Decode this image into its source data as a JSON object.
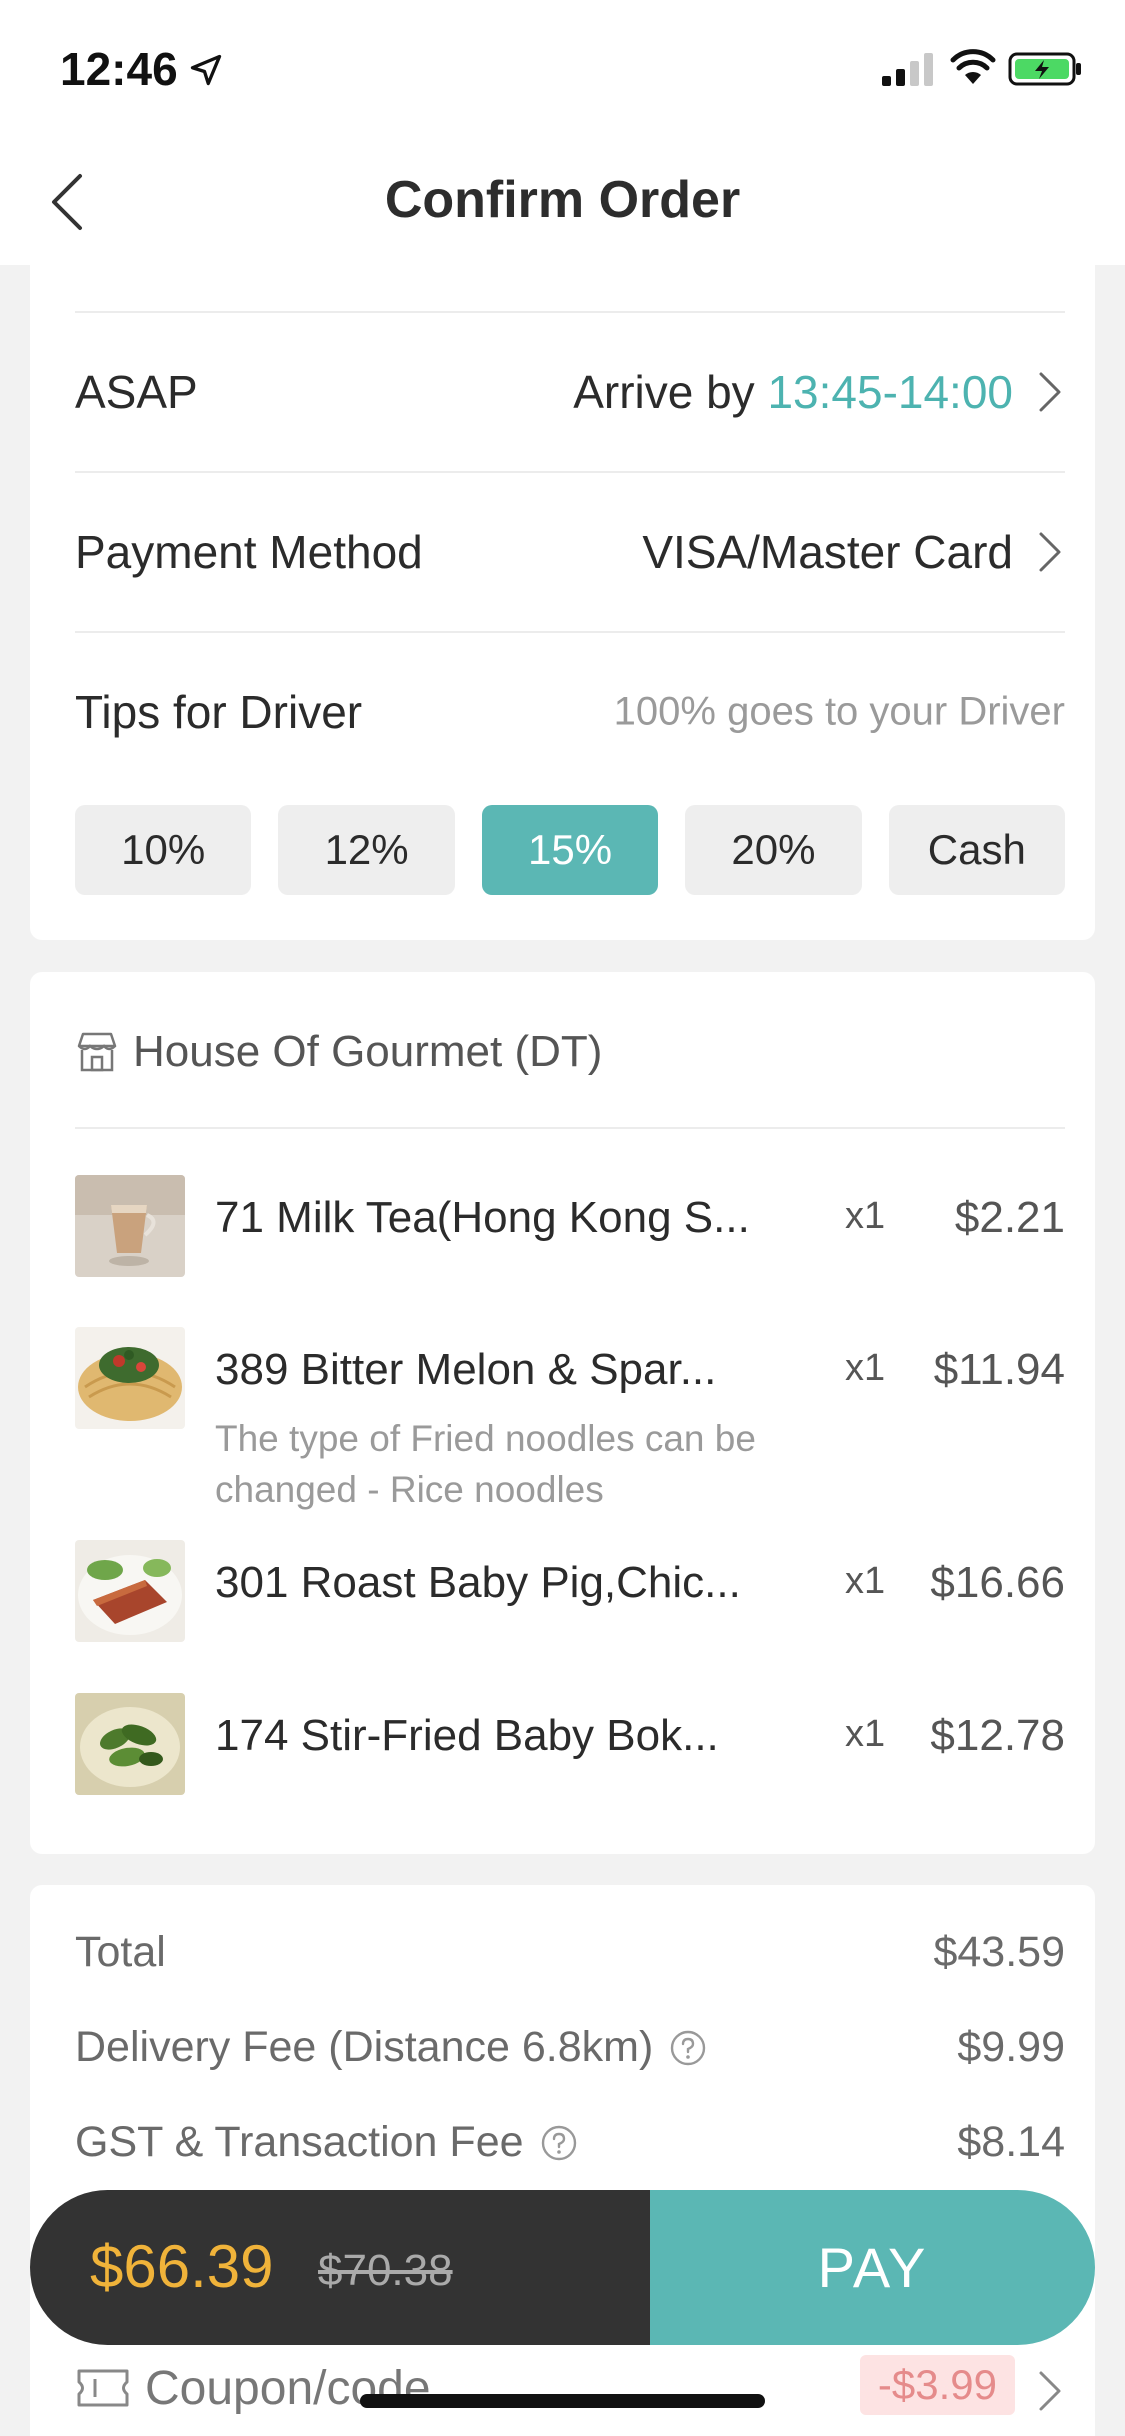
{
  "status_bar": {
    "time": "12:46"
  },
  "nav": {
    "title": "Confirm Order"
  },
  "delivery": {
    "label": "ASAP",
    "value_prefix": "Arrive by ",
    "value_time": "13:45-14:00"
  },
  "payment": {
    "label": "Payment Method",
    "value": "VISA/Master Card"
  },
  "tips": {
    "label": "Tips for Driver",
    "hint": "100% goes to your Driver",
    "options": [
      "10%",
      "12%",
      "15%",
      "20%",
      "Cash"
    ],
    "selected": "15%"
  },
  "restaurant": {
    "name": "House Of Gourmet (DT)"
  },
  "items": [
    {
      "name": "71 Milk Tea(Hong Kong S...",
      "note": "",
      "qty": "x1",
      "price": "$2.21"
    },
    {
      "name": "389 Bitter Melon & Spar...",
      "note": "The type of Fried noodles can be changed -  Rice noodles",
      "qty": "x1",
      "price": "$11.94"
    },
    {
      "name": "301 Roast Baby Pig,Chic...",
      "note": "",
      "qty": "x1",
      "price": "$16.66"
    },
    {
      "name": "174 Stir-Fried Baby Bok...",
      "note": "",
      "qty": "x1",
      "price": "$12.78"
    }
  ],
  "summary": {
    "total_label": "Total",
    "total_value": "$43.59",
    "delivery_label": "Delivery Fee (Distance 6.8km)",
    "delivery_value": "$9.99",
    "gst_label": "GST & Transaction Fee",
    "gst_value": "$8.14"
  },
  "coupon": {
    "label": "Coupon/code",
    "value": "-$3.99"
  },
  "pay": {
    "total": "$66.39",
    "original": "$70.38",
    "button": "PAY"
  },
  "colors": {
    "accent": "#5bb7b4",
    "price": "#f0b33a",
    "dark": "#333333"
  },
  "icons": [
    "location-arrow-icon",
    "signal-icon",
    "wifi-icon",
    "battery-icon",
    "back-icon",
    "chevron-right-icon",
    "store-icon",
    "help-icon",
    "coupon-icon"
  ]
}
